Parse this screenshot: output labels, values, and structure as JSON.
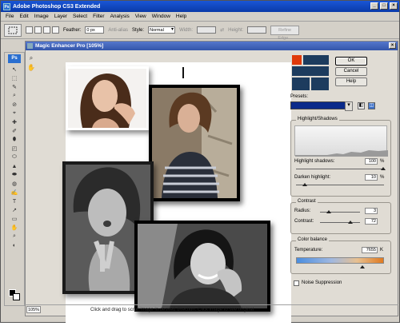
{
  "app": {
    "title": "Adobe Photoshop CS3 Extended",
    "window_buttons": [
      "_",
      "□",
      "×"
    ]
  },
  "menu": [
    "File",
    "Edit",
    "Image",
    "Layer",
    "Select",
    "Filter",
    "Analysis",
    "View",
    "Window",
    "Help"
  ],
  "options": {
    "feather_label": "Feather:",
    "feather_value": "0 px",
    "antialias_label": "Anti-alias",
    "style_label": "Style:",
    "style_value": "Normal",
    "width_label": "Width:",
    "height_label": "Height:",
    "refine_label": "Refine Edge..."
  },
  "tools": {
    "ps_badge": "Ps",
    "icons": [
      "↖",
      "⬚",
      "✎",
      "⌕",
      "⊘",
      "⌖",
      "✚",
      "✐",
      "⬮",
      "◰",
      "⬭",
      "▲",
      "⬬",
      "◍",
      "✍",
      "T",
      "↗",
      "▭",
      "✋",
      "⌕",
      "◐"
    ]
  },
  "document": {
    "title": "Magic Enhancer Pro [105%]",
    "close": "×",
    "left_tools": [
      "⌕",
      "✋"
    ]
  },
  "panel": {
    "buttons": {
      "ok": "OK",
      "cancel": "Cancel",
      "help": "Help"
    },
    "presets_label": "Presets:",
    "preset_icons": [
      "◧",
      "◫"
    ],
    "highlight_shadows": {
      "title": "Highlight/Shadows",
      "highlight_shadows_label": "Highlight shadows:",
      "highlight_shadows_value": "100",
      "darken_highlight_label": "Darken highlight:",
      "darken_highlight_value": "10",
      "unit": "%"
    },
    "contrast": {
      "title": "Contrast",
      "radius_label": "Radius:",
      "radius_value": "3",
      "contrast_label": "Contrast:",
      "contrast_value": "72"
    },
    "color_balance": {
      "title": "Color balance",
      "temperature_label": "Temperature:",
      "temperature_value": "7655",
      "temperature_unit": "K"
    },
    "noise_suppression_label": "Noise Suppression"
  },
  "status": {
    "zoom": "105%",
    "message": "Click and drag to scroll image in desired direction. Click image to see original."
  },
  "colors": {
    "title_bar": "#0a3aa8",
    "accent_orange": "#e03a0a",
    "tile_navy": "#1d3c5e"
  }
}
